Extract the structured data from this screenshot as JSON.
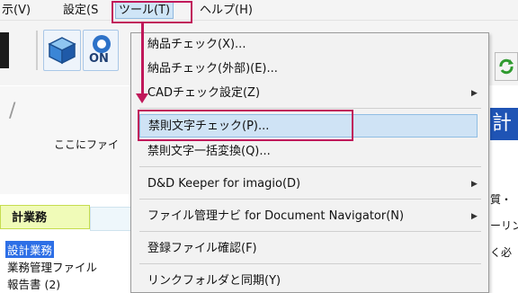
{
  "menubar": {
    "items": [
      "示(V)",
      "設定(S",
      "ツール(T)",
      "ヘルプ(H)"
    ],
    "active_index": 2
  },
  "toolbar": {
    "buttons": [
      "cube-icon",
      "on-icon",
      "refresh-icon"
    ],
    "on_label": "ON"
  },
  "left": {
    "slash": "/",
    "drop_hint": "ここにファイ",
    "tab_active": "計業務",
    "tree": [
      "設計業務",
      "業務管理ファイル",
      "報告書 (2)"
    ]
  },
  "right": {
    "title": "計",
    "lines": [
      "質・",
      "ーリン",
      "く必"
    ]
  },
  "dropdown": {
    "items": [
      {
        "label": "納品チェック(X)...",
        "submenu": false
      },
      {
        "label": "納品チェック(外部)(E)...",
        "submenu": false
      },
      {
        "label": "CADチェック設定(Z)",
        "submenu": true
      },
      {
        "label": "禁則文字チェック(P)...",
        "submenu": false,
        "highlighted": true
      },
      {
        "label": "禁則文字一括変換(Q)...",
        "submenu": false
      },
      {
        "label": "D&D Keeper for imagio(D)",
        "submenu": true
      },
      {
        "label": "ファイル管理ナビ for Document Navigator(N)",
        "submenu": true
      },
      {
        "label": "登録ファイル確認(F)",
        "submenu": false
      },
      {
        "label": "リンクフォルダと同期(Y)",
        "submenu": false
      }
    ],
    "submenu_arrow": "▶"
  },
  "annotation_color": "#c0185a"
}
